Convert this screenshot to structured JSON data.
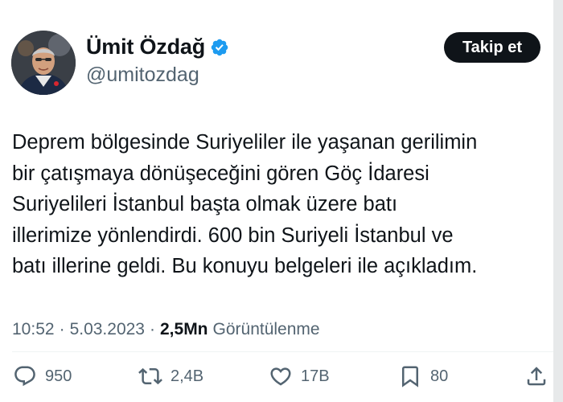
{
  "author": {
    "name": "Ümit Özdağ",
    "handle": "@umitozdag",
    "verified": true,
    "verified_color": "#1d9bf0"
  },
  "follow_button": {
    "label": "Takip et"
  },
  "tweet": {
    "lines": [
      "Deprem bölgesinde Suriyeliler ile yaşanan gerilimin",
      "bir çatışmaya dönüşeceğini gören Göç İdaresi",
      "Suriyelileri İstanbul başta olmak üzere batı",
      "illerimize yönlendirdi. 600 bin Suriyeli İstanbul ve",
      "batı illerine geldi. Bu konuyu belgeleri ile açıkladım."
    ]
  },
  "meta": {
    "time": "10:52",
    "separator": "·",
    "date": "5.03.2023",
    "views_count": "2,5Mn",
    "views_label": "Görüntülenme"
  },
  "actions": {
    "replies": "950",
    "retweets": "2,4B",
    "likes": "17B",
    "bookmarks": "80"
  },
  "icons": [
    "verified-badge-icon",
    "reply-icon",
    "retweet-icon",
    "like-icon",
    "bookmark-icon",
    "share-icon"
  ]
}
